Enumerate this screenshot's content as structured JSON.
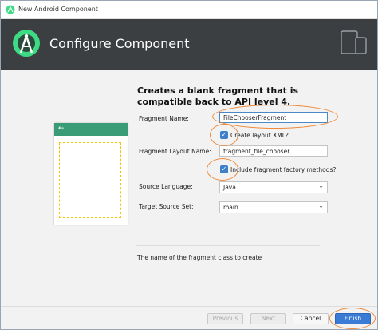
{
  "window": {
    "title": "New Android Component",
    "header_title": "Configure Component",
    "app_icon": "android-studio-icon",
    "header_icon": "android-studio-logo-icon",
    "devices_icon": "phone-tablet-icon"
  },
  "main": {
    "description": "Creates a blank fragment that is compatible back to API level 4.",
    "preview": {
      "back_icon": "←",
      "menu_icon": "⋮"
    },
    "form": {
      "fragment_name_label": "Fragment Name:",
      "fragment_name_value": "FileChooserFragment",
      "create_layout_label": "Create layout XML?",
      "create_layout_checked": true,
      "layout_name_label": "Fragment Layout Name:",
      "layout_name_value": "fragment_file_chooser",
      "factory_label": "Include fragment factory methods?",
      "factory_checked": true,
      "source_language_label": "Source Language:",
      "source_language_value": "Java",
      "target_source_label": "Target Source Set:",
      "target_source_value": "main"
    },
    "hint": "The name of the fragment class to create"
  },
  "footer": {
    "previous_label": "Previous",
    "next_label": "Next",
    "cancel_label": "Cancel",
    "finish_label": "Finish"
  },
  "colors": {
    "header_bg": "#3c3f41",
    "accent_green": "#3a9b77",
    "checkbox_blue": "#3d7fc9",
    "annotation_orange": "#ef8a3a",
    "finish_blue": "#3a7bd5"
  }
}
